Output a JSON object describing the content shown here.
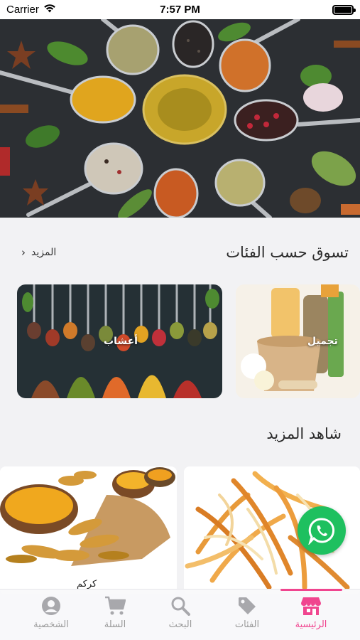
{
  "status_bar": {
    "carrier": "Carrier",
    "time": "7:57 PM"
  },
  "categories_section": {
    "title": "تسوق حسب الفئات",
    "more_label": "المزيد",
    "items": [
      {
        "label": "تجميل"
      },
      {
        "label": "أعشاب"
      }
    ]
  },
  "more_section": {
    "title": "شاهد المزيد",
    "products": [
      {
        "name": ""
      },
      {
        "name": "كركم"
      }
    ]
  },
  "tab_bar": {
    "active_color": "#f0458f",
    "items": [
      {
        "label": "الرئيسية",
        "icon": "store-icon",
        "active": true
      },
      {
        "label": "الفئات",
        "icon": "tag-icon",
        "active": false
      },
      {
        "label": "البحث",
        "icon": "search-icon",
        "active": false
      },
      {
        "label": "السلة",
        "icon": "cart-icon",
        "active": false
      },
      {
        "label": "الشخصية",
        "icon": "profile-icon",
        "active": false
      }
    ]
  },
  "colors": {
    "whatsapp": "#1ec05f",
    "accent": "#f0458f",
    "background": "#f2f2f4"
  }
}
